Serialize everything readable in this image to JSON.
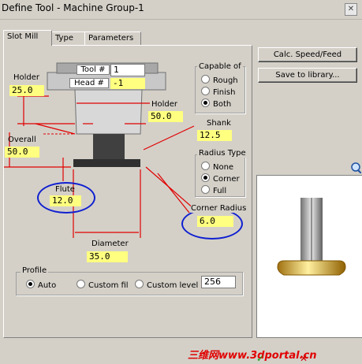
{
  "window": {
    "title": "Define Tool - Machine Group-1"
  },
  "tabs": [
    {
      "label": "Slot Mill"
    },
    {
      "label": "Type"
    },
    {
      "label": "Parameters"
    }
  ],
  "tool": {
    "tool_no_label": "Tool #",
    "tool_no": "1",
    "head_no_label": "Head #",
    "head_no": "-1"
  },
  "dims": {
    "holder_label": "Holder",
    "holder_val": "25.0",
    "holder2_label": "Holder",
    "holder2_val": "50.0",
    "shank_label": "Shank",
    "shank_val": "12.5",
    "overall_label": "Overall",
    "overall_val": "50.0",
    "flute_label": "Flute",
    "flute_val": "12.0",
    "corner_label": "Corner Radius",
    "corner_val": "6.0",
    "diameter_label": "Diameter",
    "diameter_val": "35.0"
  },
  "capable": {
    "label": "Capable of",
    "options": [
      "Rough",
      "Finish",
      "Both"
    ],
    "selected": "Both"
  },
  "radius_type": {
    "label": "Radius Type",
    "options": [
      "None",
      "Corner",
      "Full"
    ],
    "selected": "Corner"
  },
  "profile": {
    "label": "Profile",
    "options": [
      "Auto",
      "Custom fil",
      "Custom level"
    ],
    "selected": "Auto",
    "level_value": "256"
  },
  "buttons": {
    "calc": "Calc. Speed/Feed",
    "save": "Save to library..."
  },
  "watermark": "三维网www.3dportal.cn",
  "colors": {
    "field": "#ffff80",
    "annotation": "#ff0000",
    "highlight": "#1020d0"
  }
}
